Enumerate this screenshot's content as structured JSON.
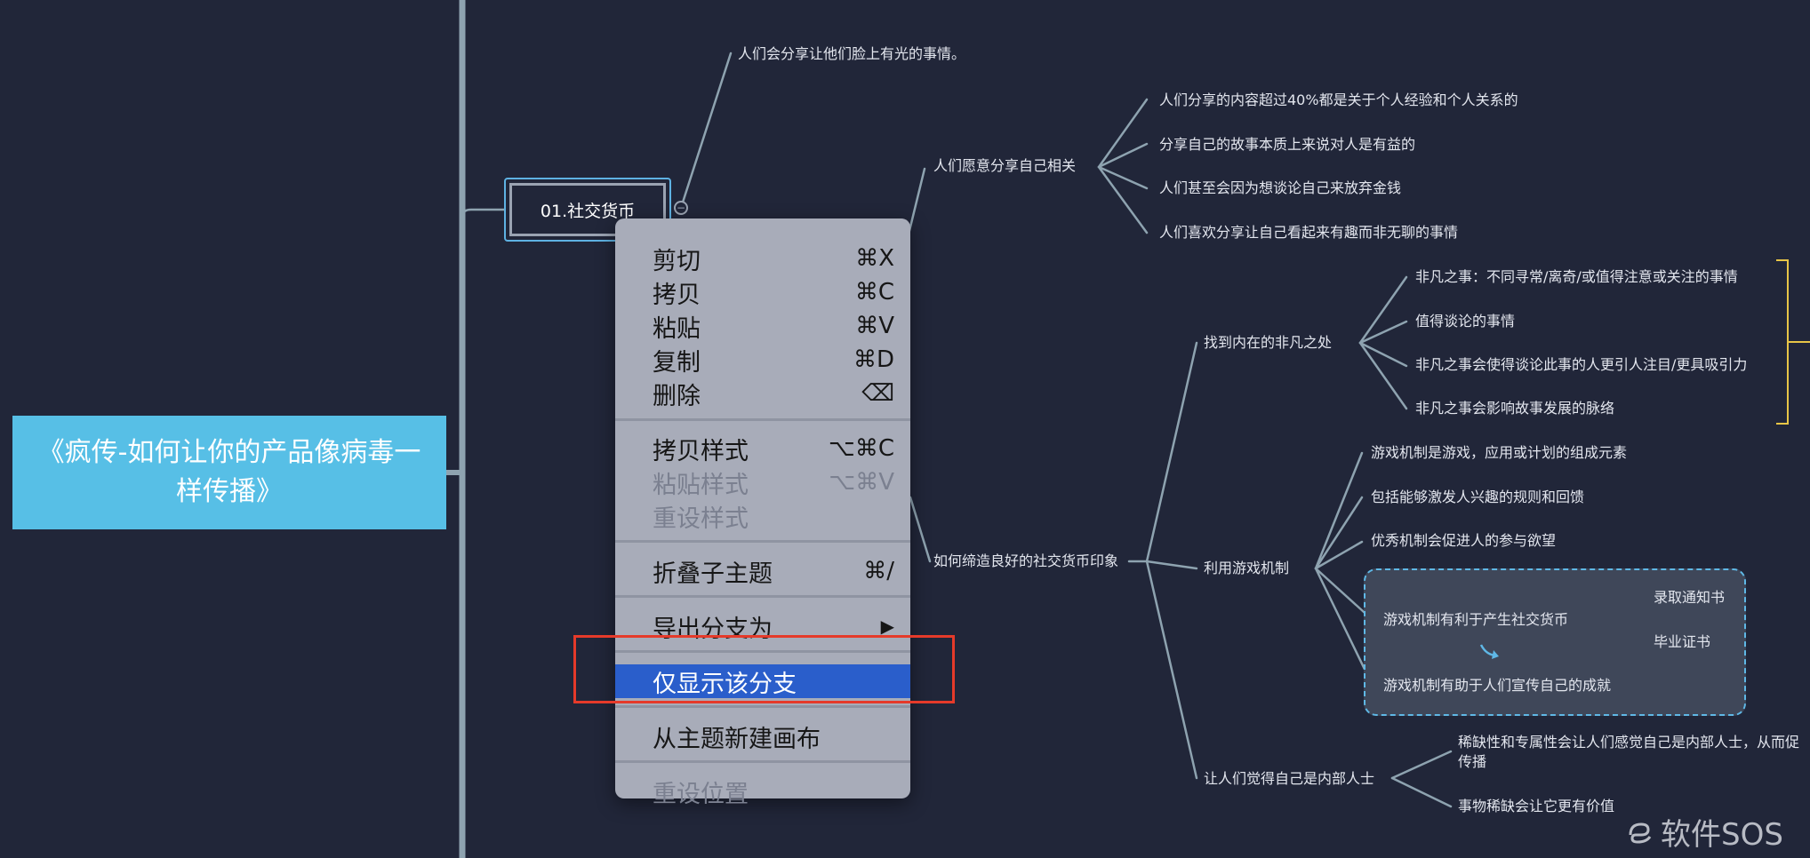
{
  "root": {
    "title": "《疯传-如何让你的产品像病毒一样传播》"
  },
  "topic": {
    "label": "01.社交货币",
    "collapse_symbol": "−"
  },
  "nodes": {
    "n_top": "人们会分享让他们脸上有光的事情。",
    "self_related": "人们愿意分享自己相关",
    "self_1": "人们分享的内容超过40%都是关于个人经验和个人关系的",
    "self_2": "分享自己的故事本质上来说对人是有益的",
    "self_3": "人们甚至会因为想谈论自己来放弃金钱",
    "self_4": "人们喜欢分享让自己看起来有趣而非无聊的事情",
    "impression": "如何缔造良好的社交货币印象",
    "remarkable": "找到内在的非凡之处",
    "rem_1": "非凡之事：不同寻常/离奇/或值得注意或关注的事情",
    "rem_2": "值得谈论的事情",
    "rem_3": "非凡之事会使得谈论此事的人更引人注目/更具吸引力",
    "rem_4": "非凡之事会影响故事发展的脉络",
    "game": "利用游戏机制",
    "game_1": "游戏机制是游戏，应用或计划的组成元素",
    "game_2": "包括能够激发人兴趣的规则和回馈",
    "game_3": "优秀机制会促进人的参与欲望",
    "game_4": "游戏机制有利于产生社交货币",
    "game_4a": "录取通知书",
    "game_4b": "毕业证书",
    "game_5": "游戏机制有助于人们宣传自己的成就",
    "insider": "让人们觉得自己是内部人士",
    "ins_1a": "稀缺性和专属性会让人们感觉自己是内部人士，从而促",
    "ins_1b": "传播",
    "ins_2": "事物稀缺会让它更有价值"
  },
  "menu": {
    "cut": {
      "label": "剪切",
      "shortcut": "⌘X"
    },
    "copy": {
      "label": "拷贝",
      "shortcut": "⌘C"
    },
    "paste": {
      "label": "粘贴",
      "shortcut": "⌘V"
    },
    "duplicate": {
      "label": "复制",
      "shortcut": "⌘D"
    },
    "delete": {
      "label": "删除",
      "shortcut": "⌫"
    },
    "copy_style": {
      "label": "拷贝样式",
      "shortcut": "⌥⌘C"
    },
    "paste_style": {
      "label": "粘贴样式",
      "shortcut": "⌥⌘V"
    },
    "reset_style": {
      "label": "重设样式",
      "shortcut": ""
    },
    "collapse": {
      "label": "折叠子主题",
      "shortcut": "⌘/"
    },
    "export": {
      "label": "导出分支为",
      "shortcut": "▶"
    },
    "show_only": {
      "label": "仅显示该分支",
      "shortcut": ""
    },
    "new_sheet": {
      "label": "从主题新建画布",
      "shortcut": ""
    },
    "reset_pos": {
      "label": "重设位置",
      "shortcut": ""
    }
  },
  "watermark": {
    "text": "软件SOS",
    "icon": "swirl-logo-icon"
  },
  "colors": {
    "background": "#212639",
    "root_fill": "#57bfe6",
    "line": "#8ea3b0",
    "selection": "#5eb2e3",
    "menu_bg": "#a8acb9",
    "menu_active": "#2a5ecb",
    "annotation_red": "#e53a2a",
    "summary_bracket": "#e8c547",
    "boundary": "#5fb8e6"
  }
}
